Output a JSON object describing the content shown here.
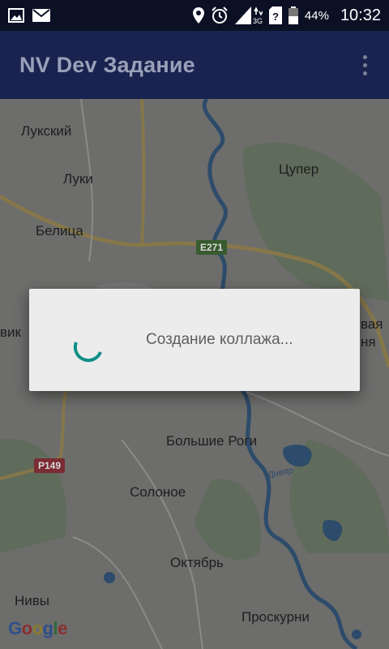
{
  "status_bar": {
    "battery_percent": "44%",
    "time": "10:32",
    "network_label": "3G",
    "icons": [
      "image-icon",
      "mail-icon",
      "location-icon",
      "alarm-icon",
      "signal-icon",
      "unknown-sim-icon",
      "battery-icon"
    ]
  },
  "app_bar": {
    "title": "NV Dev Задание",
    "overflow_icon": "more-vert-icon",
    "background": "#1a234f"
  },
  "map": {
    "places": [
      "Лукский",
      "Луки",
      "Белица",
      "Цупер",
      "Большие Роги",
      "Солоное",
      "Октябрь",
      "Нивы",
      "Проскурни",
      "вик",
      "вая",
      "ня"
    ],
    "road_shields": [
      "E271",
      "P149"
    ],
    "river_label": "Днепр",
    "attribution": "Google"
  },
  "dialog": {
    "message": "Создание коллажа...",
    "accent_color": "#0f8f86"
  }
}
